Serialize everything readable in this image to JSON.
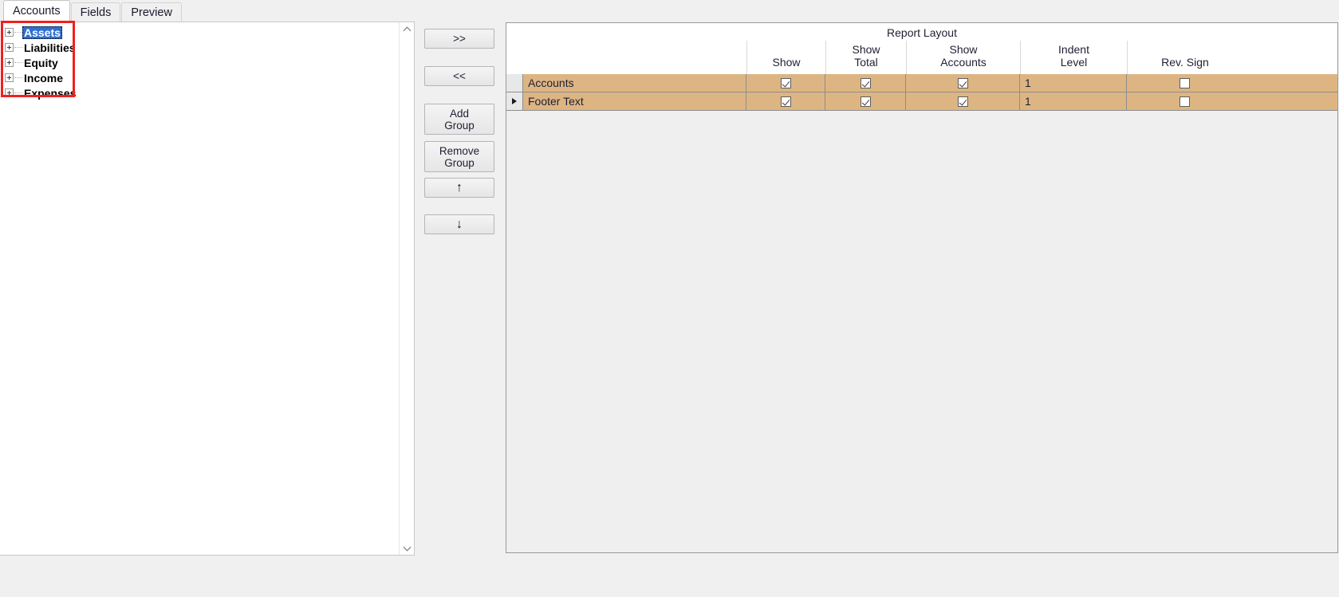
{
  "tabs": [
    {
      "label": "Accounts",
      "selected": true
    },
    {
      "label": "Fields",
      "selected": false
    },
    {
      "label": "Preview",
      "selected": false
    }
  ],
  "tree": {
    "nodes": [
      {
        "label": "Assets",
        "selected": true,
        "expander": "plus-box-icon"
      },
      {
        "label": "Liabilities",
        "selected": false,
        "expander": "plus-box-icon"
      },
      {
        "label": "Equity",
        "selected": false,
        "expander": "plus-box-icon"
      },
      {
        "label": "Income",
        "selected": false,
        "expander": "plus-box-icon"
      },
      {
        "label": "Expenses",
        "selected": false,
        "expander": "plus-box-icon"
      }
    ],
    "scroll_up_icon": "chevron-up-icon",
    "scroll_down_icon": "chevron-down-icon"
  },
  "annotation": {
    "shape": "rectangle",
    "color": "#f02020"
  },
  "buttons": {
    "move_right": ">>",
    "move_left": "<<",
    "add_group": "Add\nGroup",
    "remove_group": "Remove\nGroup",
    "move_up": "↑",
    "move_down": "↓"
  },
  "grid": {
    "band_title": "Report Layout",
    "columns": [
      {
        "key": "name",
        "label": ""
      },
      {
        "key": "show",
        "label": "Show"
      },
      {
        "key": "show_total",
        "label": "Show\nTotal"
      },
      {
        "key": "show_accounts",
        "label": "Show\nAccounts"
      },
      {
        "key": "indent_level",
        "label": "Indent\nLevel"
      },
      {
        "key": "rev_sign",
        "label": "Rev. Sign"
      }
    ],
    "rows": [
      {
        "current": false,
        "name": "Accounts",
        "show": true,
        "show_total": true,
        "show_accounts": true,
        "indent_level": "1",
        "rev_sign": false
      },
      {
        "current": true,
        "name": "Footer Text",
        "show": true,
        "show_total": true,
        "show_accounts": true,
        "indent_level": "1",
        "rev_sign": false
      }
    ]
  },
  "colors": {
    "row_fill": "#ddb583",
    "selection": "#2f6fd0",
    "annotation": "#f02020",
    "panel_bg": "#f0f0f0"
  }
}
